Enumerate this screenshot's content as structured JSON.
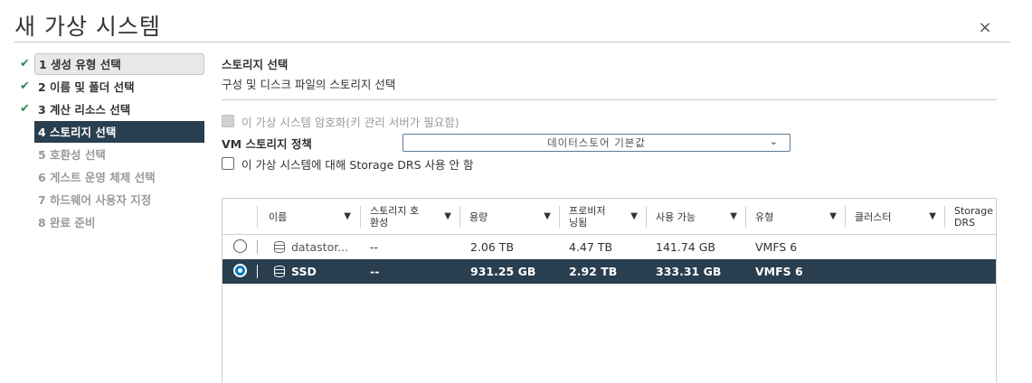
{
  "dialog": {
    "title": "새 가상 시스템",
    "close_icon": "×"
  },
  "steps": [
    {
      "label": "1 생성 유형 선택",
      "state": "done"
    },
    {
      "label": "2 이름 및 폴더 선택",
      "state": "done"
    },
    {
      "label": "3 계산 리소스 선택",
      "state": "done"
    },
    {
      "label": "4 스토리지 선택",
      "state": "current"
    },
    {
      "label": "5 호환성 선택",
      "state": "todo"
    },
    {
      "label": "6 게스트 운영 체제 선택",
      "state": "todo"
    },
    {
      "label": "7 하드웨어 사용자 지정",
      "state": "todo"
    },
    {
      "label": "8 완료 준비",
      "state": "todo"
    }
  ],
  "check_glyph": "✔",
  "section": {
    "title": "스토리지 선택",
    "subtitle": "구성 및 디스크 파일의 스토리지 선택"
  },
  "options": {
    "encrypt_label": "이 가상 시스템 암호화(키 관리 서버가 필요함)",
    "policy_label": "VM 스토리지 정책",
    "policy_value": "데이터스토어 기본값",
    "drs_label": "이 가상 시스템에 대해 Storage DRS 사용 안 함"
  },
  "table": {
    "headers": {
      "name": "이름",
      "compat": "스토리지 호\n환성",
      "capacity": "용량",
      "provisioned": "프로비저\n닝됨",
      "free": "사용 가능",
      "type": "유형",
      "cluster": "클러스터",
      "drs": "Storage\nDRS"
    },
    "filter_glyph": "▼",
    "rows": [
      {
        "name": "datastor...",
        "compat": "--",
        "capacity": "2.06 TB",
        "provisioned": "4.47 TB",
        "free": "141.74 GB",
        "type": "VMFS 6",
        "selected": false
      },
      {
        "name": "SSD",
        "compat": "--",
        "capacity": "931.25 GB",
        "provisioned": "2.92 TB",
        "free": "333.31 GB",
        "type": "VMFS 6",
        "selected": true
      }
    ]
  }
}
